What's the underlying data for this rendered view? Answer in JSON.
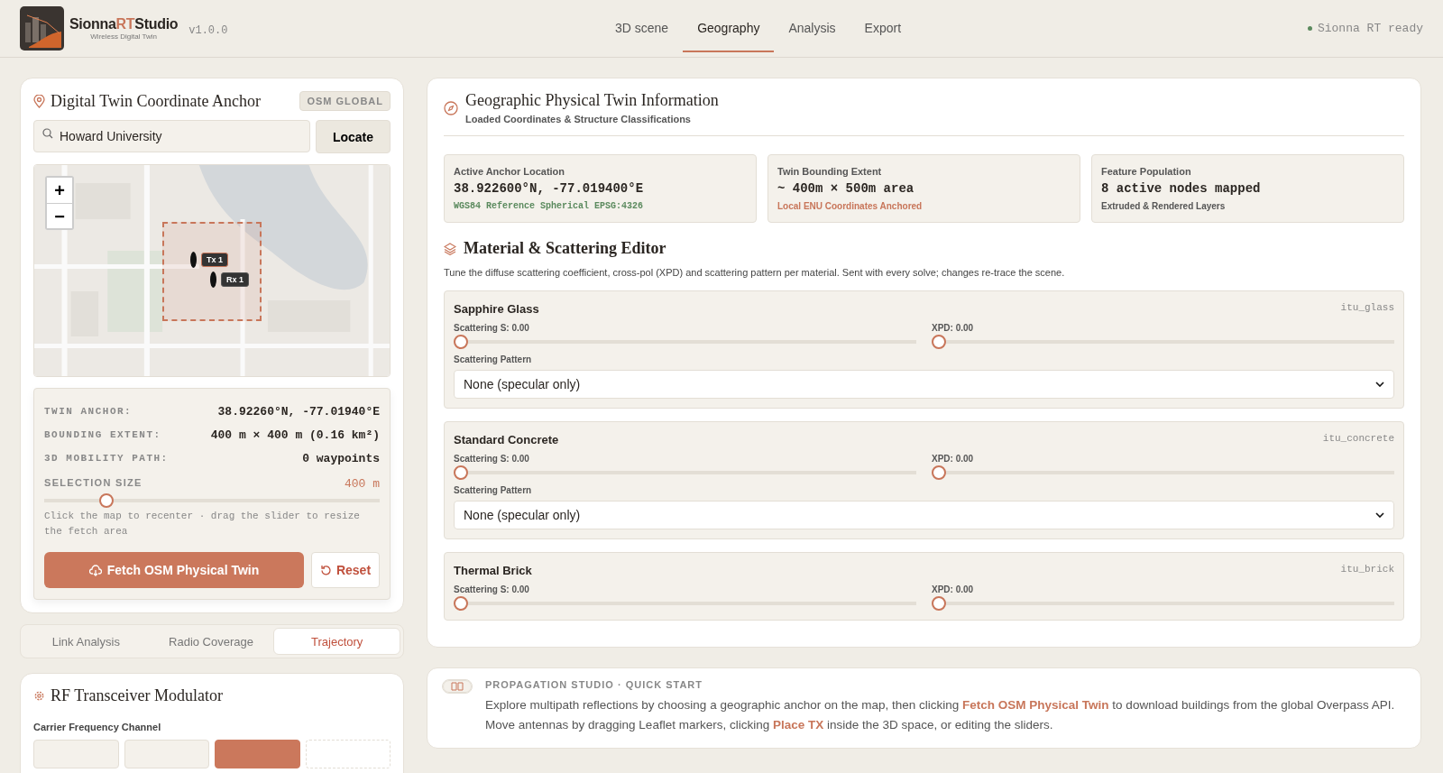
{
  "brand": {
    "name_start": "Sionna",
    "name_accent": "RT",
    "name_end": "Studio",
    "tagline": "Wireless Digital Twin",
    "version": "v1.0.0"
  },
  "nav": [
    {
      "label": "3D scene",
      "selected": false
    },
    {
      "label": "Geography",
      "selected": true
    },
    {
      "label": "Analysis",
      "selected": false
    },
    {
      "label": "Export",
      "selected": false
    }
  ],
  "status": {
    "text": "Sionna RT ready",
    "color": "#5b8a5e"
  },
  "anchor_card": {
    "title": "Digital Twin Coordinate Anchor",
    "badge": "OSM GLOBAL",
    "search": {
      "value": "Howard University"
    },
    "locate_button": "Locate",
    "map": {
      "kind": "picture",
      "zoom_in": "+",
      "zoom_out": "−",
      "markers": [
        {
          "label": "Tx 1",
          "kind": "tx"
        },
        {
          "label": "Rx 1",
          "kind": "rx"
        }
      ]
    },
    "info_rows": [
      {
        "label": "TWIN ANCHOR:",
        "value": "38.92260°N, -77.01940°E"
      },
      {
        "label": "BOUNDING EXTENT:",
        "value": "400 m × 400 m (0.16 km²)"
      },
      {
        "label": "3D MOBILITY PATH:",
        "value": "0 waypoints"
      }
    ],
    "selection": {
      "label": "SELECTION SIZE",
      "reading": "400 m",
      "level": 0.17,
      "hint": "Click the map to recenter · drag the slider to resize the fetch area"
    },
    "fetch_button": "Fetch OSM Physical Twin",
    "reset_button": "Reset"
  },
  "mode_tabs": [
    {
      "label": "Link Analysis",
      "selected": false
    },
    {
      "label": "Radio Coverage",
      "selected": false
    },
    {
      "label": "Trajectory",
      "selected": true
    }
  ],
  "rf_card": {
    "title": "RF Transceiver Modulator",
    "field_label": "Carrier Frequency Channel",
    "options": [
      {
        "selected": false,
        "kind": "solid"
      },
      {
        "selected": false,
        "kind": "solid"
      },
      {
        "selected": true,
        "kind": "solid"
      },
      {
        "selected": false,
        "kind": "dashed"
      }
    ]
  },
  "info_panel": {
    "title": "Geographic Physical Twin Information",
    "subtitle": "Loaded Coordinates & Structure Classifications",
    "stats": [
      {
        "label": "Active Anchor Location",
        "value": "38.922600°N, -77.019400°E",
        "note": "WGS84 Reference Spherical EPSG:4326",
        "kind": "mono"
      },
      {
        "label": "Twin Bounding Extent",
        "value": "~ 400m × 500m area",
        "note": "Local ENU Coordinates Anchored",
        "kind": "accent"
      },
      {
        "label": "Feature Population",
        "value": "8 active nodes mapped",
        "note": "Extruded & Rendered Layers",
        "kind": "plain"
      }
    ],
    "editor_title": "Material & Scattering Editor",
    "editor_text": "Tune the diffuse scattering coefficient, cross-pol (XPD) and scattering pattern per material. Sent with every solve; changes re-trace the scene.",
    "materials": [
      {
        "name": "Sapphire Glass",
        "id": "itu_glass",
        "scattering": {
          "label": "Scattering S: 0.00",
          "level": 0
        },
        "xpd": {
          "label": "XPD: 0.00",
          "level": 0
        },
        "pattern_label": "Scattering Pattern",
        "pattern": "None (specular only)"
      },
      {
        "name": "Standard Concrete",
        "id": "itu_concrete",
        "scattering": {
          "label": "Scattering S: 0.00",
          "level": 0
        },
        "xpd": {
          "label": "XPD: 0.00",
          "level": 0
        },
        "pattern_label": "Scattering Pattern",
        "pattern": "None (specular only)"
      },
      {
        "name": "Thermal Brick",
        "id": "itu_brick",
        "scattering": {
          "label": "Scattering S: 0.00",
          "level": 0
        },
        "xpd": {
          "label": "XPD: 0.00",
          "level": 0
        }
      }
    ]
  },
  "quick_start": {
    "title": "PROPAGATION STUDIO · QUICK START",
    "text": [
      "Explore multipath reflections by choosing a geographic anchor on the map, then clicking ",
      {
        "link": "Fetch OSM Physical Twin"
      },
      " to download buildings from the global Overpass API. Move antennas by dragging Leaflet markers, clicking ",
      {
        "link": "Place TX"
      },
      " inside the 3D space, or editing the sliders."
    ]
  }
}
